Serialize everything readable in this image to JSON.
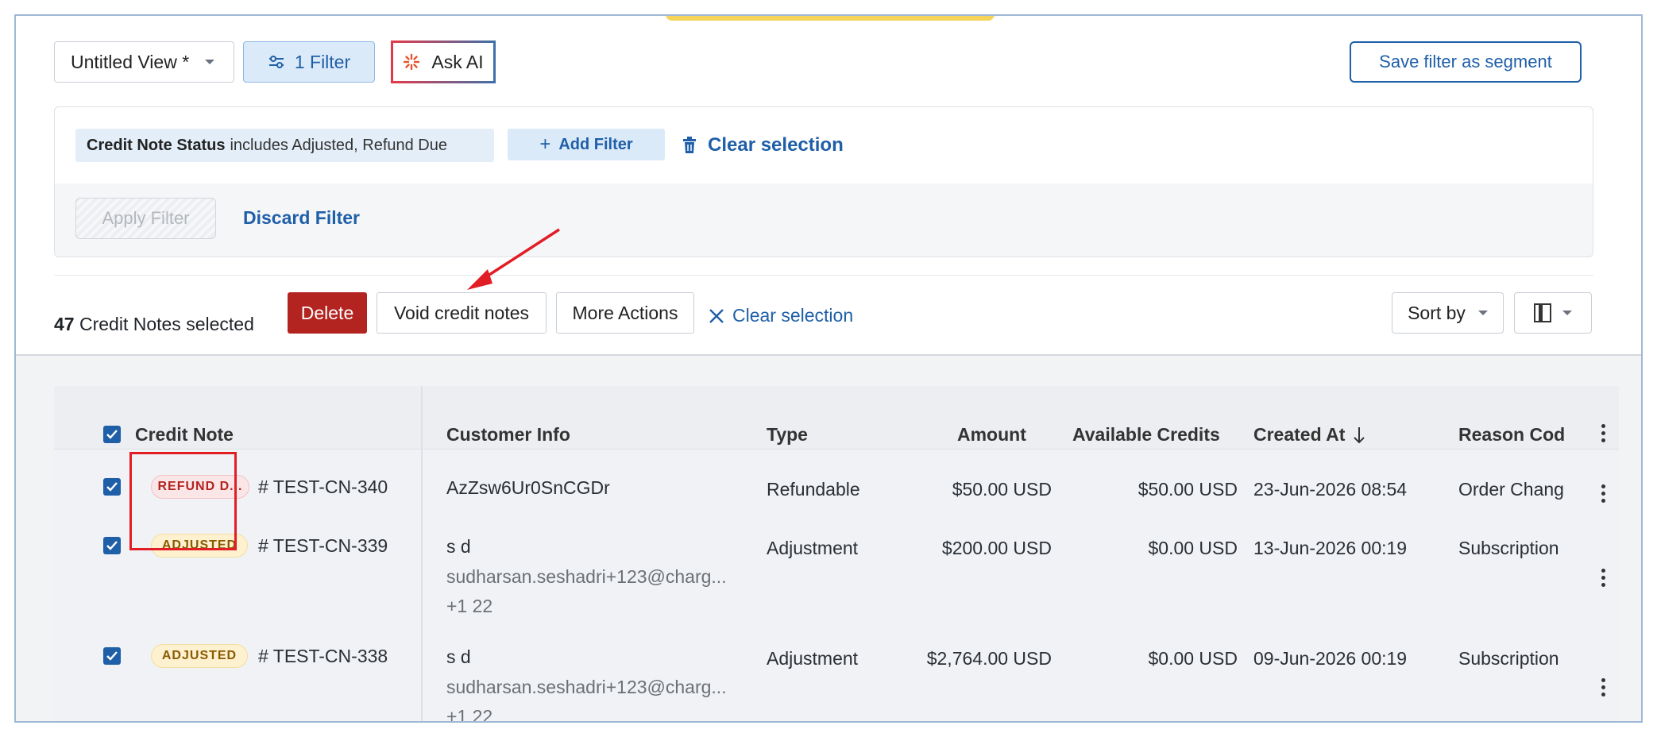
{
  "toolbar": {
    "view_label": "Untitled View *",
    "filter_label": "1 Filter",
    "ask_ai_label": "Ask AI",
    "save_segment_label": "Save filter as segment"
  },
  "filters": {
    "chip_field": "Credit Note Status",
    "chip_value": "includes Adjusted, Refund Due",
    "add_filter_label": "Add Filter",
    "clear_selection_label": "Clear selection",
    "apply_label": "Apply Filter",
    "discard_label": "Discard Filter"
  },
  "selection": {
    "count": "47",
    "text": "Credit Notes selected",
    "delete_label": "Delete",
    "void_label": "Void credit notes",
    "more_label": "More Actions",
    "clear_label": "Clear selection",
    "sort_label": "Sort by"
  },
  "table": {
    "headers": {
      "credit_note": "Credit Note",
      "customer_info": "Customer Info",
      "type": "Type",
      "amount": "Amount",
      "available_credits": "Available Credits",
      "created_at": "Created At",
      "reason_code": "Reason Cod"
    },
    "rows": [
      {
        "status": "REFUND D...",
        "id": "# TEST-CN-340",
        "customer": "AzZsw6Ur0SnCGDr",
        "email": "",
        "phone": "",
        "type": "Refundable",
        "amount": "$50.00 USD",
        "available": "$50.00 USD",
        "created": "23-Jun-2026 08:54",
        "reason": "Order Chang"
      },
      {
        "status": "ADJUSTED",
        "id": "# TEST-CN-339",
        "customer": "s d",
        "email": "sudharsan.seshadri+123@charg...",
        "phone": "+1 22",
        "type": "Adjustment",
        "amount": "$200.00 USD",
        "available": "$0.00 USD",
        "created": "13-Jun-2026 00:19",
        "reason": "Subscription"
      },
      {
        "status": "ADJUSTED",
        "id": "# TEST-CN-338",
        "customer": "s d",
        "email": "sudharsan.seshadri+123@charg...",
        "phone": "+1 22",
        "type": "Adjustment",
        "amount": "$2,764.00 USD",
        "available": "$0.00 USD",
        "created": "09-Jun-2026 00:19",
        "reason": "Subscription"
      }
    ]
  },
  "colors": {
    "primary": "#1f5fa8",
    "danger": "#b3231f",
    "annotation": "#e11d26",
    "accent": "#f6d45a"
  }
}
